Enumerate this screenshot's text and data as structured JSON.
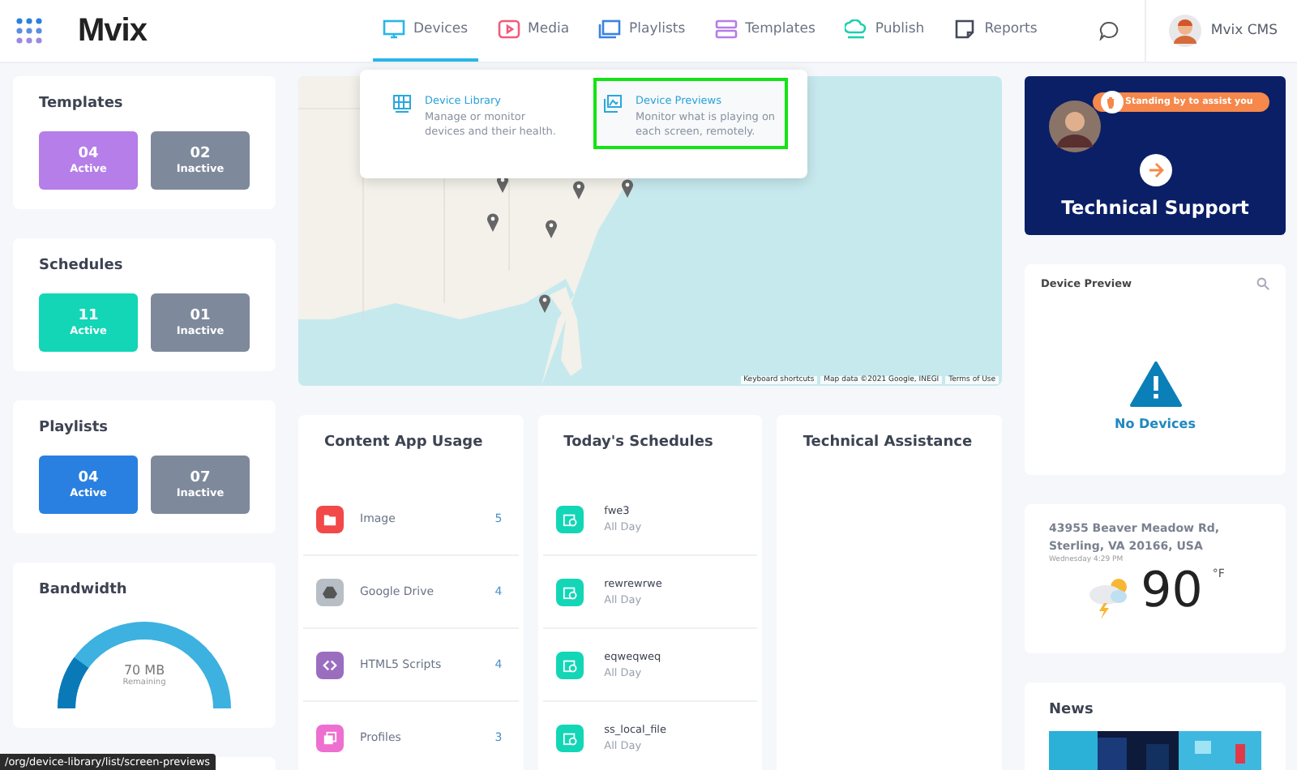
{
  "header": {
    "logo": "Mvix",
    "nav": [
      {
        "label": "Devices",
        "color": "#29b6e8",
        "selected": true
      },
      {
        "label": "Media",
        "color": "#f25a7a",
        "selected": false
      },
      {
        "label": "Playlists",
        "color": "#3b82e0",
        "selected": false
      },
      {
        "label": "Templates",
        "color": "#b57ee8",
        "selected": false
      },
      {
        "label": "Publish",
        "color": "#1ccfb0",
        "selected": false
      },
      {
        "label": "Reports",
        "color": "#444b5a",
        "selected": false
      }
    ],
    "user": "Mvix CMS"
  },
  "devices_menu": [
    {
      "title": "Device Library",
      "description": "Manage or monitor devices and their health.",
      "selected": false
    },
    {
      "title": "Device Previews",
      "description": "Monitor what is playing on each screen, remotely.",
      "selected": true
    }
  ],
  "summaries": [
    {
      "title": "Templates",
      "tiles": [
        {
          "count": "04",
          "label": "Active",
          "color": "#b57ee8"
        },
        {
          "count": "02",
          "label": "Inactive",
          "color": "#7f899c"
        }
      ]
    },
    {
      "title": "Schedules",
      "tiles": [
        {
          "count": "11",
          "label": "Active",
          "color": "#12d6b6"
        },
        {
          "count": "01",
          "label": "Inactive",
          "color": "#7f899c"
        }
      ]
    },
    {
      "title": "Playlists",
      "tiles": [
        {
          "count": "04",
          "label": "Active",
          "color": "#2a80e0"
        },
        {
          "count": "07",
          "label": "Inactive",
          "color": "#7f899c"
        }
      ]
    }
  ],
  "bandwidth": {
    "title": "Bandwidth",
    "value": "70 MB",
    "caption": "Remaining"
  },
  "map": {
    "attribution": [
      "Keyboard shortcuts",
      "Map data ©2021 Google, INEGI",
      "Terms of Use"
    ]
  },
  "content_app_usage": {
    "title": "Content App Usage",
    "items": [
      {
        "name": "Image",
        "count": "5",
        "color": "#f24848"
      },
      {
        "name": "Google Drive",
        "count": "4",
        "color": "#b8bec6"
      },
      {
        "name": "HTML5 Scripts",
        "count": "4",
        "color": "#9b6dbf"
      },
      {
        "name": "Profiles",
        "count": "3",
        "color": "#ee6fd0"
      }
    ]
  },
  "todays_schedules": {
    "title": "Today's Schedules",
    "items": [
      {
        "name": "fwe3",
        "time": "All Day"
      },
      {
        "name": "rewrewrwe",
        "time": "All Day"
      },
      {
        "name": "eqweqweq",
        "time": "All Day"
      },
      {
        "name": "ss_local_file",
        "time": "All Day"
      }
    ]
  },
  "technical_assistance": {
    "title": "Technical Assistance"
  },
  "support_banner": {
    "bubble": "Standing by to assist you",
    "title": "Technical Support"
  },
  "device_preview": {
    "title": "Device Preview",
    "empty": "No Devices"
  },
  "weather": {
    "address": "43955 Beaver Meadow Rd, Sterling, VA 20166, USA",
    "time": "Wednesday 4:29 PM",
    "temperature": "90",
    "unit": "°F"
  },
  "news": {
    "title": "News"
  },
  "status_url": "/org/device-library/list/screen-previews"
}
